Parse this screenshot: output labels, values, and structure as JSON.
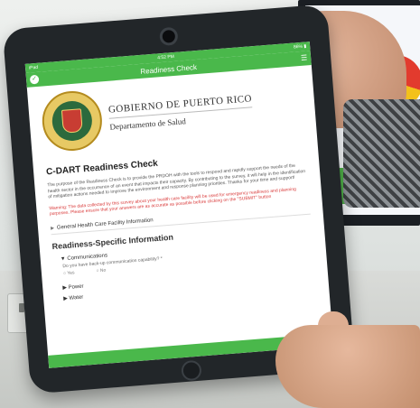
{
  "app": {
    "status_left": "iPad",
    "status_time": "4:52 PM",
    "status_right": "86% ▮",
    "title": "Readiness Check"
  },
  "org": {
    "line1": "GOBIERNO DE PUERTO RICO",
    "line2": "Departamento de Salud"
  },
  "form": {
    "title": "C-DART Readiness Check",
    "description": "The purpose of the Readiness Check is to provide the PRDOH with the tools to respond and rapidly support the needs of the health sector in the occurrence of an event that impacts their capacity. By contributing to the survey, it will help in the identification of mitigation actions needed to improve the environment and response planning priorities. Thanks for your time and support!",
    "warning": "Warning: The data collected by this survey about your health care facility will be used for emergency readiness and planning purposes. Please ensure that your answers are as accurate as possible before clicking on the \"SUBMIT\" button",
    "sections": {
      "general": "General Health Care Facility Information",
      "specific": "Readiness-Specific Information",
      "communications": "Communications",
      "power": "Power",
      "water": "Water"
    },
    "question": "Do you have back-up communication capability? *",
    "opt_yes": "Yes",
    "opt_no": "No"
  }
}
